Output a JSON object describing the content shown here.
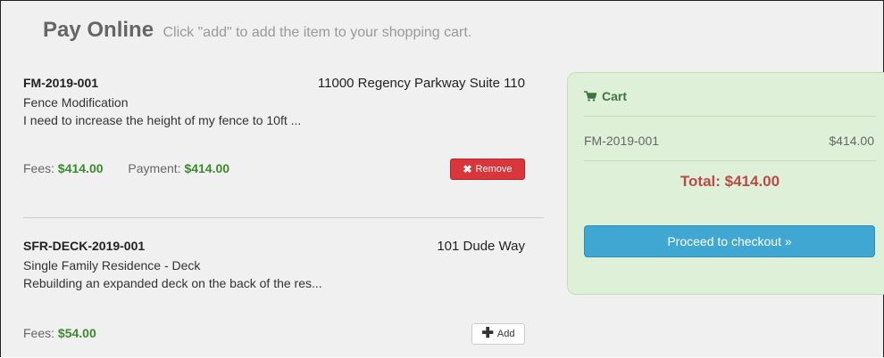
{
  "header": {
    "title": "Pay Online",
    "subtitle": "Click \"add\" to add the item to your shopping cart."
  },
  "items": [
    {
      "code": "FM-2019-001",
      "address": "11000 Regency Parkway Suite 110",
      "type": "Fence Modification",
      "description": "I need to increase the height of my fence to 10ft ...",
      "fees_label": "Fees:",
      "fees": "$414.00",
      "payment_label": "Payment:",
      "payment": "$414.00",
      "action_label": "Remove",
      "action_icon": "x-icon"
    },
    {
      "code": "SFR-DECK-2019-001",
      "address": "101 Dude Way",
      "type": "Single Family Residence - Deck",
      "description": "Rebuilding an expanded deck on the back of the res...",
      "fees_label": "Fees:",
      "fees": "$54.00",
      "action_label": "Add",
      "action_icon": "plus-icon"
    }
  ],
  "cart": {
    "title": "Cart",
    "icon": "shopping-cart-icon",
    "lines": [
      {
        "code": "FM-2019-001",
        "amount": "$414.00"
      }
    ],
    "total": "Total: $414.00",
    "checkout_label": "Proceed to checkout »"
  },
  "colors": {
    "money_green": "#3c8a2e",
    "remove_red": "#d9353b",
    "cart_bg": "#dff0d8",
    "total_red": "#b94a48",
    "checkout_blue": "#3fa7d2"
  }
}
